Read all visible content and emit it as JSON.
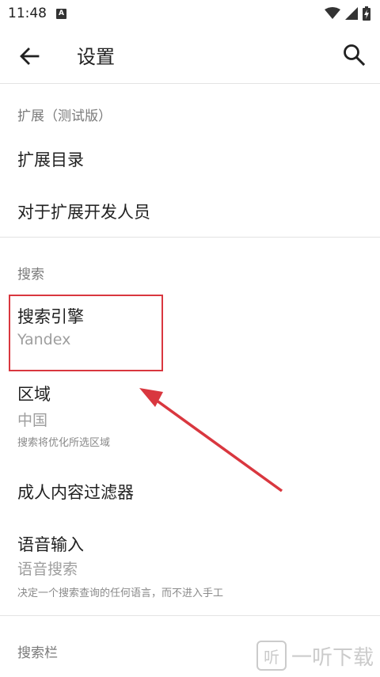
{
  "status_bar": {
    "time": "11:48",
    "notification_icon": "A",
    "icons": [
      "wifi-icon",
      "signal-icon",
      "battery-icon"
    ]
  },
  "app_bar": {
    "title": "设置",
    "back_icon": "arrow-left-icon",
    "search_icon": "search-icon"
  },
  "sections": {
    "extensions": {
      "header": "扩展（测试版）",
      "items": [
        {
          "title": "扩展目录"
        },
        {
          "title": "对于扩展开发人员"
        }
      ]
    },
    "search": {
      "header": "搜索",
      "items": [
        {
          "title": "搜索引擎",
          "value": "Yandex"
        },
        {
          "title": "区域",
          "value": "中国",
          "description": "搜索将优化所选区域"
        },
        {
          "title": "成人内容过滤器"
        },
        {
          "title": "语音输入",
          "value": "语音搜索",
          "description": "决定一个搜索查询的任何语言，而不进入手工"
        }
      ]
    },
    "search_bar": {
      "header": "搜索栏"
    }
  },
  "annotation": {
    "box_color": "#d9373f",
    "arrow_color": "#d9373f"
  },
  "watermark": {
    "logo": "听",
    "text": "一听下载"
  }
}
